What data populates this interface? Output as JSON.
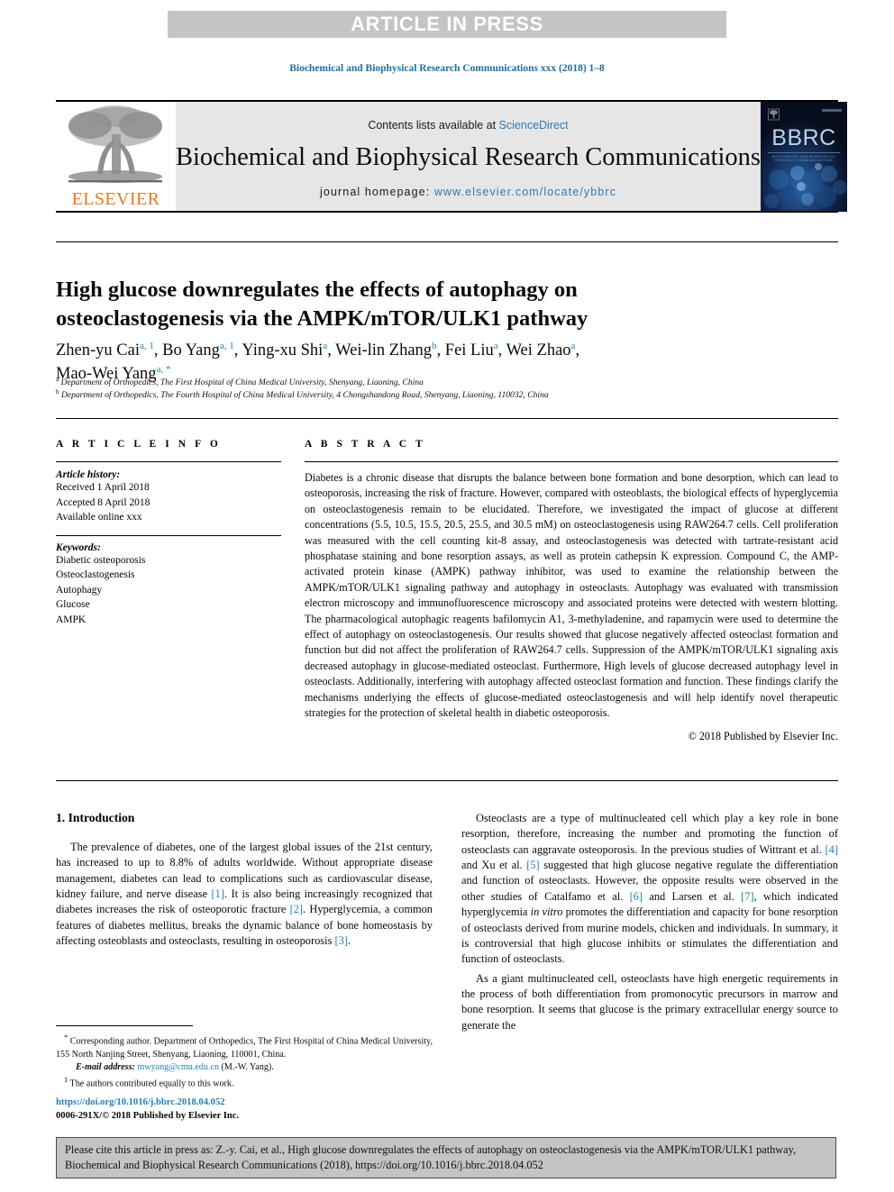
{
  "banner": {
    "text": "ARTICLE IN PRESS",
    "bg_color": "#c4c4c4"
  },
  "running_head": {
    "text": "Biochemical and Biophysical Research Communications xxx (2018) 1–8",
    "color": "#1f6f9e"
  },
  "masthead": {
    "publisher_name": "ELSEVIER",
    "publisher_color": "#e87722",
    "contents_prefix": "Contents lists available at ",
    "contents_link": "ScienceDirect",
    "journal_name": "Biochemical and Biophysical Research Communications",
    "homepage_label": "journal homepage: ",
    "homepage_url": "www.elsevier.com/locate/ybbrc",
    "link_color": "#2e7ab4",
    "cover": {
      "title": "BBRC",
      "subtitle": "BIOCHEMICAL AND BIOPHYSICAL RESEARCH COMMUNICATIONS"
    }
  },
  "article": {
    "title": "High glucose downregulates the effects of autophagy on osteoclastogenesis via the AMPK/mTOR/ULK1 pathway",
    "authors_line1": "Zhen-yu Cai ^a,1^, Bo Yang ^a,1^, Ying-xu Shi ^a^, Wei-lin Zhang ^b^, Fei Liu ^a^, Wei Zhao ^a^,",
    "authors_line2": "Mao-Wei Yang ^a,*^",
    "authors": [
      {
        "name": "Zhen-yu Cai",
        "marks": "a, 1"
      },
      {
        "name": "Bo Yang",
        "marks": "a, 1"
      },
      {
        "name": "Ying-xu Shi",
        "marks": "a"
      },
      {
        "name": "Wei-lin Zhang",
        "marks": "b"
      },
      {
        "name": "Fei Liu",
        "marks": "a"
      },
      {
        "name": "Wei Zhao",
        "marks": "a"
      },
      {
        "name": "Mao-Wei Yang",
        "marks": "a, *"
      }
    ],
    "affiliation_a": "Department of Orthopedics, The First Hospital of China Medical University, Shenyang, Liaoning, China",
    "affiliation_b": "Department of Orthopedics, The Fourth Hospital of China Medical University, 4 Chongshandong Road, Shenyang, Liaoning, 110032, China"
  },
  "article_info": {
    "heading": "A R T I C L E  I N F O",
    "history_label": "Article history:",
    "history": [
      "Received 1 April 2018",
      "Accepted 8 April 2018",
      "Available online xxx"
    ],
    "keywords_label": "Keywords:",
    "keywords": [
      "Diabetic osteoporosis",
      "Osteoclastogenesis",
      "Autophagy",
      "Glucose",
      "AMPK"
    ]
  },
  "abstract": {
    "heading": "A B S T R A C T",
    "body": "Diabetes is a chronic disease that disrupts the balance between bone formation and bone desorption, which can lead to osteoporosis, increasing the risk of fracture. However, compared with osteoblasts, the biological effects of hyperglycemia on osteoclastogenesis remain to be elucidated. Therefore, we investigated the impact of glucose at different concentrations (5.5, 10.5, 15.5, 20.5, 25.5, and 30.5 mM) on osteoclastogenesis using RAW264.7 cells. Cell proliferation was measured with the cell counting kit-8 assay, and osteoclastogenesis was detected with tartrate-resistant acid phosphatase staining and bone resorption assays, as well as protein cathepsin K expression. Compound C, the AMP-activated protein kinase (AMPK) pathway inhibitor, was used to examine the relationship between the AMPK/mTOR/ULK1 signaling pathway and autophagy in osteoclasts. Autophagy was evaluated with transmission electron microscopy and immunofluorescence microscopy and associated proteins were detected with western blotting. The pharmacological autophagic reagents bafilomycin A1, 3-methyladenine, and rapamycin were used to determine the effect of autophagy on osteoclastogenesis. Our results showed that glucose negatively affected osteoclast formation and function but did not affect the proliferation of RAW264.7 cells. Suppression of the AMPK/mTOR/ULK1 signaling axis decreased autophagy in glucose-mediated osteoclast. Furthermore, High levels of glucose decreased autophagy level in osteoclasts. Additionally, interfering with autophagy affected osteoclast formation and function. These findings clarify the mechanisms underlying the effects of glucose-mediated osteoclastogenesis and will help identify novel therapeutic strategies for the protection of skeletal health in diabetic osteoporosis.",
    "copyright": "© 2018 Published by Elsevier Inc."
  },
  "introduction": {
    "heading": "1. Introduction",
    "left_paragraph_1_pre": "The prevalence of diabetes, one of the largest global issues of the 21st century, has increased to up to 8.8% of adults worldwide. Without appropriate disease management, diabetes can lead to complications such as cardiovascular disease, kidney failure, and nerve disease ",
    "left_paragraph_1_ref1": "[1]",
    "left_paragraph_1_mid": ". It is also being increasingly recognized that diabetes increases the risk of osteoporotic fracture ",
    "left_paragraph_1_ref2": "[2]",
    "left_paragraph_1_mid2": ". Hyperglycemia, a common features of diabetes mellitus, breaks the dynamic balance of bone homeostasis by affecting osteoblasts and osteoclasts, resulting in osteoporosis ",
    "left_paragraph_1_ref3": "[3]",
    "left_paragraph_1_end": ".",
    "right_paragraph_1_pre": "Osteoclasts are a type of multinucleated cell which play a key role in bone resorption, therefore, increasing the number and promoting the function of osteoclasts can aggravate osteoporosis. In the previous studies of Wittrant et al. ",
    "right_paragraph_1_ref4": "[4]",
    "right_paragraph_1_a": " and Xu et al. ",
    "right_paragraph_1_ref5": "[5]",
    "right_paragraph_1_b": " suggested that high glucose negative regulate the differentiation and function of osteoclasts. However, the opposite results were observed in the other studies of Catalfamo et al. ",
    "right_paragraph_1_ref6": "[6]",
    "right_paragraph_1_c": " and Larsen et al. ",
    "right_paragraph_1_ref7": "[7]",
    "right_paragraph_1_d": ", which indicated hyperglycemia ",
    "right_paragraph_1_invitro": "in vitro",
    "right_paragraph_1_e": " promotes the differentiation and capacity for bone resorption of osteoclasts derived from murine models, chicken and individuals. In summary, it is controversial that high glucose inhibits or stimulates the differentiation and function of osteoclasts.",
    "right_paragraph_2": "As a giant multinucleated cell, osteoclasts have high energetic requirements in the process of both differentiation from promonocytic precursors in marrow and bone resorption. It seems that glucose is the primary extracellular energy source to generate the"
  },
  "footnotes": {
    "corresponding_mark": "*",
    "corresponding": " Corresponding author. Department of Orthopedics, The First Hospital of China Medical University, 155 North Nanjing Street, Shenyang, Liaoning, 110001, China.",
    "email_label": "E-mail address:",
    "email": "mwyang@cmu.edu.cn",
    "email_suffix": " (M.-W. Yang).",
    "equal_mark": "1",
    "equal_contribution": " The authors contributed equally to this work."
  },
  "doi_block": {
    "doi_url": "https://doi.org/10.1016/j.bbrc.2018.04.052",
    "issn_line": "0006-291X/© 2018 Published by Elsevier Inc."
  },
  "citation_footer": {
    "text": "Please cite this article in press as: Z.-y. Cai, et al., High glucose downregulates the effects of autophagy on osteoclastogenesis via the AMPK/mTOR/ULK1 pathway, Biochemical and Biophysical Research Communications (2018), https://doi.org/10.1016/j.bbrc.2018.04.052",
    "bg_color": "#c4c4c4"
  }
}
